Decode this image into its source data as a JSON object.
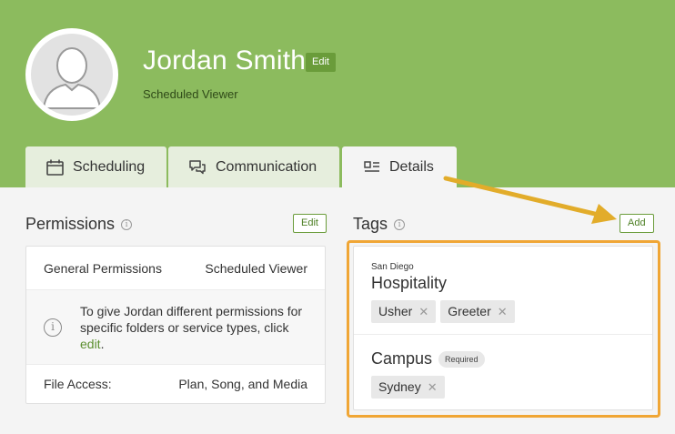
{
  "profile": {
    "name": "Jordan Smith",
    "edit_label": "Edit",
    "role": "Scheduled Viewer"
  },
  "tabs": [
    {
      "label": "Scheduling",
      "icon": "calendar-icon"
    },
    {
      "label": "Communication",
      "icon": "chat-icon"
    },
    {
      "label": "Details",
      "icon": "details-icon",
      "active": true
    }
  ],
  "permissions": {
    "title": "Permissions",
    "edit_label": "Edit",
    "general_label": "General Permissions",
    "general_value": "Scheduled Viewer",
    "note_text": "To give Jordan different permissions for specific folders or service types, click ",
    "note_link": "edit",
    "note_end": ".",
    "file_label": "File Access:",
    "file_value": "Plan, Song, and Media"
  },
  "tags": {
    "title": "Tags",
    "add_label": "Add",
    "groups": [
      {
        "subtitle": "San Diego",
        "name": "Hospitality",
        "chips": [
          "Usher",
          "Greeter"
        ]
      },
      {
        "name": "Campus",
        "badge": "Required",
        "chips": [
          "Sydney"
        ]
      }
    ]
  },
  "colors": {
    "header": "#8cbb5e",
    "accent": "#6a9c3a",
    "highlight": "#f0a635",
    "arrow": "#e2ac2a"
  }
}
